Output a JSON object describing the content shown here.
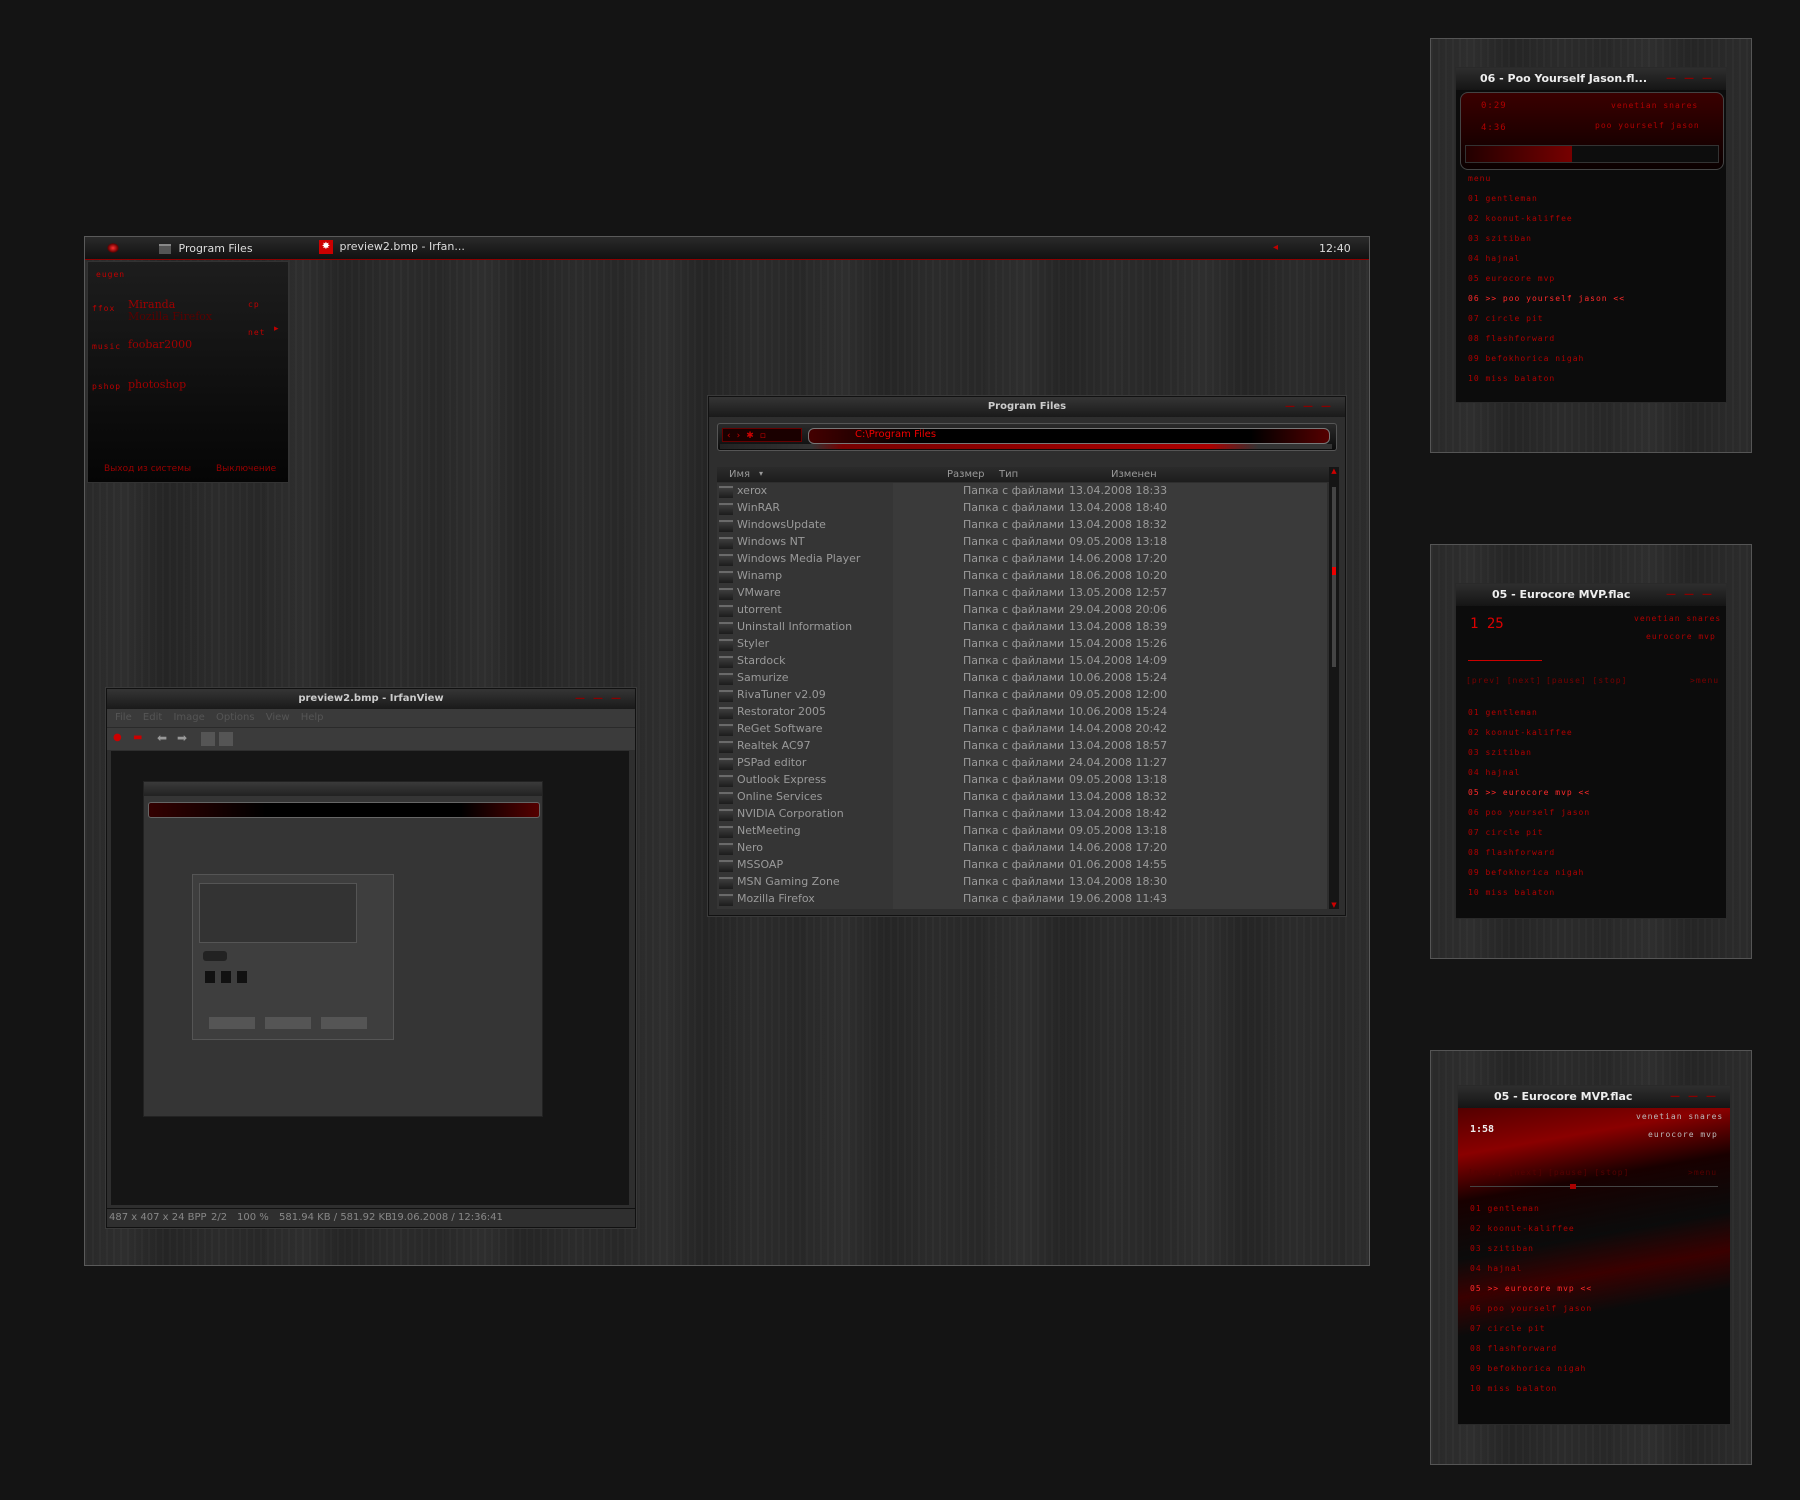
{
  "taskbar": {
    "tasks": [
      {
        "label": "Program Files"
      },
      {
        "label": "preview2.bmp - Irfan..."
      }
    ],
    "clock": "12:40"
  },
  "start_menu": {
    "user": "eugen",
    "groups": [
      {
        "tag": "ffox",
        "items": [
          "Miranda",
          "Mozilla Firefox"
        ]
      },
      {
        "tag": "music",
        "items": [
          "foobar2000"
        ]
      },
      {
        "tag": "pshop",
        "items": [
          "photoshop"
        ]
      }
    ],
    "right_items": [
      "cp",
      "net"
    ],
    "logoff": "Выход из системы",
    "shutdown": "Выключение"
  },
  "explorer": {
    "title": "Program Files",
    "address": "C:\\Program Files",
    "columns": [
      "Имя",
      "Размер",
      "Тип",
      "Изменен"
    ],
    "files": [
      {
        "name": "xerox",
        "type": "Папка с файлами",
        "date": "13.04.2008 18:33"
      },
      {
        "name": "WinRAR",
        "type": "Папка с файлами",
        "date": "13.04.2008 18:40"
      },
      {
        "name": "WindowsUpdate",
        "type": "Папка с файлами",
        "date": "13.04.2008 18:32"
      },
      {
        "name": "Windows NT",
        "type": "Папка с файлами",
        "date": "09.05.2008 13:18"
      },
      {
        "name": "Windows Media Player",
        "type": "Папка с файлами",
        "date": "14.06.2008 17:20"
      },
      {
        "name": "Winamp",
        "type": "Папка с файлами",
        "date": "18.06.2008 10:20"
      },
      {
        "name": "VMware",
        "type": "Папка с файлами",
        "date": "13.05.2008 12:57"
      },
      {
        "name": "utorrent",
        "type": "Папка с файлами",
        "date": "29.04.2008 20:06"
      },
      {
        "name": "Uninstall Information",
        "type": "Папка с файлами",
        "date": "13.04.2008 18:39"
      },
      {
        "name": "Styler",
        "type": "Папка с файлами",
        "date": "15.04.2008 15:26"
      },
      {
        "name": "Stardock",
        "type": "Папка с файлами",
        "date": "15.04.2008 14:09"
      },
      {
        "name": "Samurize",
        "type": "Папка с файлами",
        "date": "10.06.2008 15:24"
      },
      {
        "name": "RivaTuner v2.09",
        "type": "Папка с файлами",
        "date": "09.05.2008 12:00"
      },
      {
        "name": "Restorator 2005",
        "type": "Папка с файлами",
        "date": "10.06.2008 15:24"
      },
      {
        "name": "ReGet Software",
        "type": "Папка с файлами",
        "date": "14.04.2008 20:42"
      },
      {
        "name": "Realtek AC97",
        "type": "Папка с файлами",
        "date": "13.04.2008 18:57"
      },
      {
        "name": "PSPad editor",
        "type": "Папка с файлами",
        "date": "24.04.2008 11:27"
      },
      {
        "name": "Outlook Express",
        "type": "Папка с файлами",
        "date": "09.05.2008 13:18"
      },
      {
        "name": "Online Services",
        "type": "Папка с файлами",
        "date": "13.04.2008 18:32"
      },
      {
        "name": "NVIDIA Corporation",
        "type": "Папка с файлами",
        "date": "13.04.2008 18:42"
      },
      {
        "name": "NetMeeting",
        "type": "Папка с файлами",
        "date": "09.05.2008 13:18"
      },
      {
        "name": "Nero",
        "type": "Папка с файлами",
        "date": "14.06.2008 17:20"
      },
      {
        "name": "MSSOAP",
        "type": "Папка с файлами",
        "date": "01.06.2008 14:55"
      },
      {
        "name": "MSN Gaming Zone",
        "type": "Папка с файлами",
        "date": "13.04.2008 18:30"
      },
      {
        "name": "Mozilla Firefox",
        "type": "Папка с файлами",
        "date": "19.06.2008 11:43"
      }
    ]
  },
  "irfanview": {
    "title": "preview2.bmp - IrfanView",
    "menu": [
      "File",
      "Edit",
      "Image",
      "Options",
      "View",
      "Help"
    ],
    "status": [
      "487 x 407 x 24 BPP",
      "2/2",
      "100 %",
      "581.94 KB / 581.92 KB",
      "19.06.2008 / 12:36:41"
    ]
  },
  "players": [
    {
      "title": "06 - Poo Yourself Jason.fl...",
      "elapsed": "0:29",
      "total": "4:36",
      "artist": "venetian snares",
      "song": "poo yourself jason",
      "menu_label": "menu",
      "controls": [],
      "tracks": [
        "01  gentleman",
        "02  koonut-kaliffee",
        "03  szitiban",
        "04  hajnal",
        "05  eurocore mvp",
        "06  >> poo yourself jason <<",
        "07  circle pit",
        "08  flashforward",
        "09  befokhorica nigah",
        "10  miss balaton"
      ],
      "current_index": 5
    },
    {
      "title": "05 - Eurocore MVP.flac",
      "elapsed": "1 25",
      "artist": "venetian snares",
      "song": "eurocore mvp",
      "menu_label": ">menu",
      "controls": [
        "[prev] [next]",
        "[pause] [stop]"
      ],
      "tracks": [
        "01  gentleman",
        "02  koonut-kaliffee",
        "03  szitiban",
        "04  hajnal",
        "05  >> eurocore mvp <<",
        "06  poo yourself jason",
        "07  circle pit",
        "08  flashforward",
        "09  befokhorica nigah",
        "10  miss balaton"
      ],
      "current_index": 4
    },
    {
      "title": "05 - Eurocore MVP.flac",
      "elapsed": "1:58",
      "artist": "venetian snares",
      "song": "eurocore mvp",
      "menu_label": ">menu",
      "controls": [
        "[prev] [next]",
        "[pause] [stop]"
      ],
      "tracks": [
        "01  gentleman",
        "02  koonut-kaliffee",
        "03  szitiban",
        "04  hajnal",
        "05  >> eurocore mvp <<",
        "06  poo yourself jason",
        "07  circle pit",
        "08  flashforward",
        "09  befokhorica nigah",
        "10  miss balaton"
      ],
      "current_index": 4
    }
  ]
}
